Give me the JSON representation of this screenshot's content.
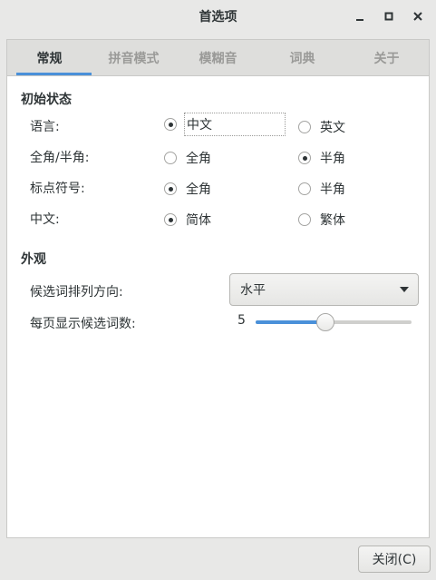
{
  "window": {
    "title": "首选项"
  },
  "tabs": [
    {
      "label": "常规",
      "active": true
    },
    {
      "label": "拼音模式",
      "active": false
    },
    {
      "label": "模糊音",
      "active": false
    },
    {
      "label": "词典",
      "active": false
    },
    {
      "label": "关于",
      "active": false
    }
  ],
  "initial_state": {
    "heading": "初始状态",
    "rows": [
      {
        "label": "语言:",
        "option1": "中文",
        "option2": "英文",
        "selected": 1
      },
      {
        "label": "全角/半角:",
        "option1": "全角",
        "option2": "半角",
        "selected": 2
      },
      {
        "label": "标点符号:",
        "option1": "全角",
        "option2": "半角",
        "selected": 1
      },
      {
        "label": "中文:",
        "option1": "简体",
        "option2": "繁体",
        "selected": 1
      }
    ]
  },
  "appearance": {
    "heading": "外观",
    "orientation_label": "候选词排列方向:",
    "orientation_value": "水平",
    "page_size_label": "每页显示候选词数:",
    "page_size_value": "5",
    "page_size_fraction": 0.44
  },
  "footer": {
    "close_label": "关闭(C)"
  },
  "colors": {
    "accent": "#4a90d9",
    "background": "#e8e8e7",
    "panel": "#ffffff"
  }
}
